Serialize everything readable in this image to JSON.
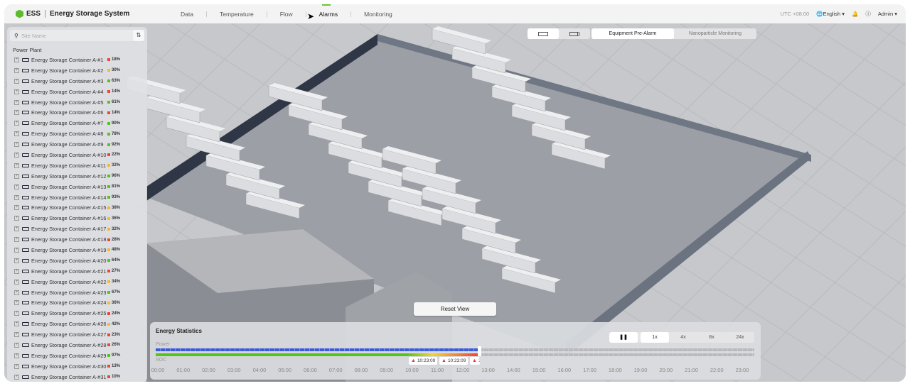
{
  "header": {
    "logo": "ESS",
    "title": "Energy Storage System",
    "nav": [
      {
        "label": "Data"
      },
      {
        "label": "Temperature"
      },
      {
        "label": "Flow"
      },
      {
        "label": "Alarms"
      },
      {
        "label": "Monitoring"
      }
    ],
    "active_nav": "Alarms",
    "timezone": "UTC +08:00",
    "language": "English",
    "user": "Admin"
  },
  "sidebar": {
    "search_placeholder": "Site Name",
    "group": "Power Plant",
    "items": [
      {
        "name": "Energy Storage Container A-#1",
        "pct": "18%",
        "status": "red"
      },
      {
        "name": "Energy Storage Container A-#2",
        "pct": "30%",
        "status": "yellow"
      },
      {
        "name": "Energy Storage Container A-#3",
        "pct": "63%",
        "status": "green"
      },
      {
        "name": "Energy Storage Container A-#4",
        "pct": "14%",
        "status": "red"
      },
      {
        "name": "Energy Storage Container A-#5",
        "pct": "61%",
        "status": "green"
      },
      {
        "name": "Energy Storage Container A-#6",
        "pct": "14%",
        "status": "red"
      },
      {
        "name": "Energy Storage Container A-#7",
        "pct": "90%",
        "status": "green"
      },
      {
        "name": "Energy Storage Container A-#8",
        "pct": "78%",
        "status": "green"
      },
      {
        "name": "Energy Storage Container A-#9",
        "pct": "92%",
        "status": "green"
      },
      {
        "name": "Energy Storage Container A-#10",
        "pct": "22%",
        "status": "red"
      },
      {
        "name": "Energy Storage Container A-#11",
        "pct": "32%",
        "status": "yellow"
      },
      {
        "name": "Energy Storage Container A-#12",
        "pct": "96%",
        "status": "green"
      },
      {
        "name": "Energy Storage Container A-#13",
        "pct": "81%",
        "status": "green"
      },
      {
        "name": "Energy Storage Container A-#14",
        "pct": "93%",
        "status": "green"
      },
      {
        "name": "Energy Storage Container A-#15",
        "pct": "38%",
        "status": "yellow"
      },
      {
        "name": "Energy Storage Container A-#16",
        "pct": "36%",
        "status": "yellow"
      },
      {
        "name": "Energy Storage Container A-#17",
        "pct": "32%",
        "status": "yellow"
      },
      {
        "name": "Energy Storage Container A-#18",
        "pct": "28%",
        "status": "red"
      },
      {
        "name": "Energy Storage Container A-#19",
        "pct": "48%",
        "status": "yellow"
      },
      {
        "name": "Energy Storage Container A-#20",
        "pct": "64%",
        "status": "green"
      },
      {
        "name": "Energy Storage Container A-#21",
        "pct": "27%",
        "status": "red"
      },
      {
        "name": "Energy Storage Container A-#22",
        "pct": "34%",
        "status": "yellow"
      },
      {
        "name": "Energy Storage Container A-#23",
        "pct": "67%",
        "status": "green"
      },
      {
        "name": "Energy Storage Container A-#24",
        "pct": "36%",
        "status": "yellow"
      },
      {
        "name": "Energy Storage Container A-#25",
        "pct": "24%",
        "status": "red"
      },
      {
        "name": "Energy Storage Container A-#26",
        "pct": "42%",
        "status": "yellow"
      },
      {
        "name": "Energy Storage Container A-#27",
        "pct": "23%",
        "status": "red"
      },
      {
        "name": "Energy Storage Container A-#28",
        "pct": "26%",
        "status": "red"
      },
      {
        "name": "Energy Storage Container A-#29",
        "pct": "97%",
        "status": "green"
      },
      {
        "name": "Energy Storage Container A-#30",
        "pct": "13%",
        "status": "red"
      },
      {
        "name": "Energy Storage Container A-#31",
        "pct": "10%",
        "status": "red"
      }
    ]
  },
  "colors": {
    "red": "#f04438",
    "yellow": "#f5b82e",
    "green": "#52c41a",
    "power": "#3b5bdb",
    "soc": "#52c41a"
  },
  "view_tabs": [
    {
      "label": "Equipment Pre-Alarm"
    },
    {
      "label": "Nanoparticle Monitoring"
    }
  ],
  "reset_label": "Reset View",
  "stats": {
    "title": "Energy Statistics",
    "power_label": "Power",
    "soc_label": "SOC",
    "pause": "❚❚",
    "speeds": [
      "1x",
      "4x",
      "8x",
      "24x"
    ],
    "active_speed": "1x",
    "progress_hours": 12.6,
    "ticks": [
      "00:00",
      "01:00",
      "02:00",
      "03:00",
      "04:00",
      "05:00",
      "06:00",
      "07:00",
      "08:00",
      "09:00",
      "10:00",
      "11:00",
      "12:00",
      "13:00",
      "14:00",
      "15:00",
      "16:00",
      "17:00",
      "18:00",
      "19:00",
      "20:00",
      "21:00",
      "22:00",
      "23:00"
    ],
    "alarms": [
      {
        "time": "10:23:09"
      },
      {
        "time": "10:23:09"
      },
      {
        "time": "3"
      }
    ]
  }
}
